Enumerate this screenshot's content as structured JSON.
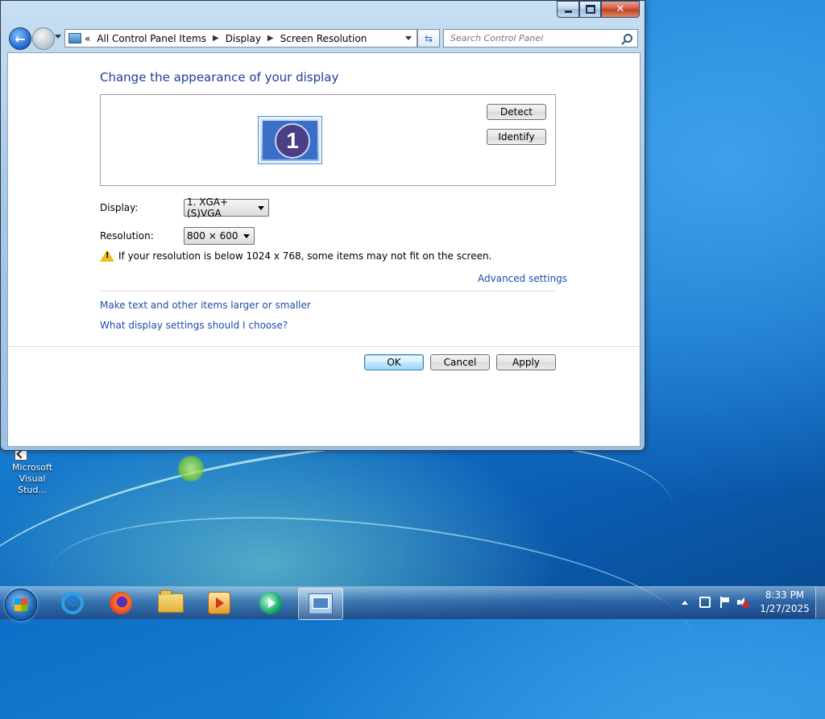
{
  "window": {
    "address": {
      "chevron": "«",
      "crumbs": [
        "All Control Panel Items",
        "Display",
        "Screen Resolution"
      ]
    },
    "search_placeholder": "Search Control Panel"
  },
  "content": {
    "heading": "Change the appearance of your display",
    "monitor_number": "1",
    "detect_label": "Detect",
    "identify_label": "Identify",
    "display_label": "Display:",
    "display_value": "1. XGA+(S)VGA",
    "resolution_label": "Resolution:",
    "resolution_value": "800 × 600",
    "warning_text": "If your resolution is below 1024 x 768, some items may not fit on the screen.",
    "advanced_link": "Advanced settings",
    "link_text_size": "Make text and other items larger or smaller",
    "link_help": "What display settings should I choose?",
    "ok_label": "OK",
    "cancel_label": "Cancel",
    "apply_label": "Apply"
  },
  "desktop": {
    "icon_label": "Microsoft Visual Stud..."
  },
  "taskbar": {
    "apps": [
      "internet-explorer-icon",
      "firefox-icon",
      "file-explorer-icon",
      "media-center-icon",
      "media-player-icon",
      "control-panel-icon"
    ],
    "time": "8:33 PM",
    "date": "1/27/2025"
  },
  "colors": {
    "heading": "#1e3f9c",
    "link": "#1e4ca8",
    "desktop": "#1a86d8"
  }
}
